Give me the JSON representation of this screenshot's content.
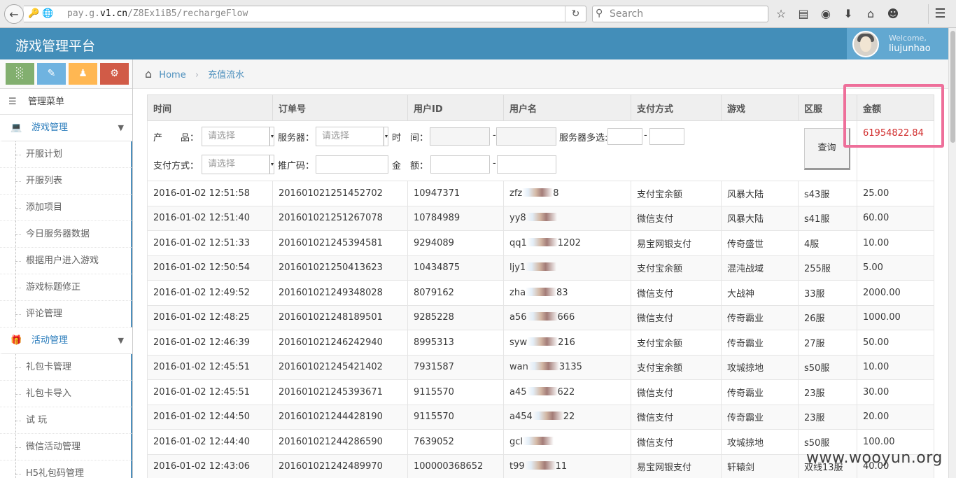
{
  "browser": {
    "url_prefix": "pay.g.",
    "url_host": "v1.cn",
    "url_path": "/Z8Ex1iB5/rechargeFlow",
    "search_placeholder": "Search"
  },
  "header": {
    "title": "游戏管理平台",
    "welcome": "Welcome,",
    "username": "liujunhao"
  },
  "sidebar": {
    "menu_title": "管理菜单",
    "groups": [
      {
        "label": "游戏管理",
        "items": [
          "开服计划",
          "开服列表",
          "添加项目",
          "今日服务器数据",
          "根据用户进入游戏",
          "游戏标题修正",
          "评论管理"
        ]
      },
      {
        "label": "活动管理",
        "items": [
          "礼包卡管理",
          "礼包卡导入",
          "试 玩",
          "微信活动管理",
          "H5礼包码管理"
        ]
      }
    ]
  },
  "breadcrumb": {
    "home": "Home",
    "current": "充值流水"
  },
  "table": {
    "headers": [
      "时间",
      "订单号",
      "用户ID",
      "用户名",
      "支付方式",
      "游戏",
      "区服",
      "金额"
    ],
    "total_amount": "61954822.84",
    "filters": {
      "product_label": "产　　品：",
      "product_placeholder": "请选择",
      "server_label": "服务器：",
      "server_placeholder": "请选择",
      "time_label": "时　间：",
      "multi_server_label": "服务器多选:",
      "pay_label": "支付方式：",
      "pay_placeholder": "请选择",
      "promo_label": "推广码：",
      "amount_label": "金　额：",
      "dash": "-",
      "query_button": "查询"
    },
    "rows": [
      {
        "time": "2016-01-02 12:51:58",
        "order": "201601021251452702",
        "uid": "10947371",
        "name_a": "zfz",
        "name_b": "8",
        "pay": "支付宝余额",
        "game": "风暴大陆",
        "zone": "s43服",
        "amount": "25.00"
      },
      {
        "time": "2016-01-02 12:51:40",
        "order": "201601021251267078",
        "uid": "10784989",
        "name_a": "yy8",
        "name_b": "",
        "pay": "微信支付",
        "game": "风暴大陆",
        "zone": "s41服",
        "amount": "60.00"
      },
      {
        "time": "2016-01-02 12:51:33",
        "order": "201601021245394581",
        "uid": "9294089",
        "name_a": "qq1",
        "name_b": "1202",
        "pay": "易宝网银支付",
        "game": "传奇盛世",
        "zone": "4服",
        "amount": "10.00"
      },
      {
        "time": "2016-01-02 12:50:54",
        "order": "201601021250413623",
        "uid": "10434875",
        "name_a": "ljy1",
        "name_b": "",
        "pay": "支付宝余额",
        "game": "混沌战域",
        "zone": "255服",
        "amount": "5.00"
      },
      {
        "time": "2016-01-02 12:49:52",
        "order": "201601021249348028",
        "uid": "8079162",
        "name_a": "zha",
        "name_b": "83",
        "pay": "微信支付",
        "game": "大战神",
        "zone": "33服",
        "amount": "2000.00"
      },
      {
        "time": "2016-01-02 12:48:25",
        "order": "201601021248189501",
        "uid": "9285228",
        "name_a": "a56",
        "name_b": "666",
        "pay": "微信支付",
        "game": "传奇霸业",
        "zone": "26服",
        "amount": "1000.00"
      },
      {
        "time": "2016-01-02 12:46:39",
        "order": "201601021246242940",
        "uid": "8995313",
        "name_a": "syw",
        "name_b": "216",
        "pay": "支付宝余额",
        "game": "传奇霸业",
        "zone": "27服",
        "amount": "50.00"
      },
      {
        "time": "2016-01-02 12:45:51",
        "order": "201601021245421402",
        "uid": "7931587",
        "name_a": "wan",
        "name_b": "3135",
        "pay": "支付宝余额",
        "game": "攻城掠地",
        "zone": "s50服",
        "amount": "10.00"
      },
      {
        "time": "2016-01-02 12:45:51",
        "order": "201601021245393671",
        "uid": "9115570",
        "name_a": "a45",
        "name_b": "622",
        "pay": "微信支付",
        "game": "传奇霸业",
        "zone": "23服",
        "amount": "30.00"
      },
      {
        "time": "2016-01-02 12:44:50",
        "order": "201601021244428190",
        "uid": "9115570",
        "name_a": "a454",
        "name_b": "22",
        "pay": "微信支付",
        "game": "传奇霸业",
        "zone": "23服",
        "amount": "20.00"
      },
      {
        "time": "2016-01-02 12:44:40",
        "order": "201601021244286590",
        "uid": "7639052",
        "name_a": "gcl",
        "name_b": "",
        "pay": "微信支付",
        "game": "攻城掠地",
        "zone": "s50服",
        "amount": "100.00"
      },
      {
        "time": "2016-01-02 12:43:06",
        "order": "201601021242489970",
        "uid": "100000368652",
        "name_a": "t99",
        "name_b": "11",
        "pay": "易宝网银支付",
        "game": "轩辕剑",
        "zone": "双线13服",
        "amount": "40.00"
      }
    ]
  },
  "watermark": "www.wooyun.org",
  "colors": {
    "header": "#438eb9",
    "link": "#4c8fbd",
    "amount": "#d12c2c",
    "highlight": "#ee6f9a"
  }
}
